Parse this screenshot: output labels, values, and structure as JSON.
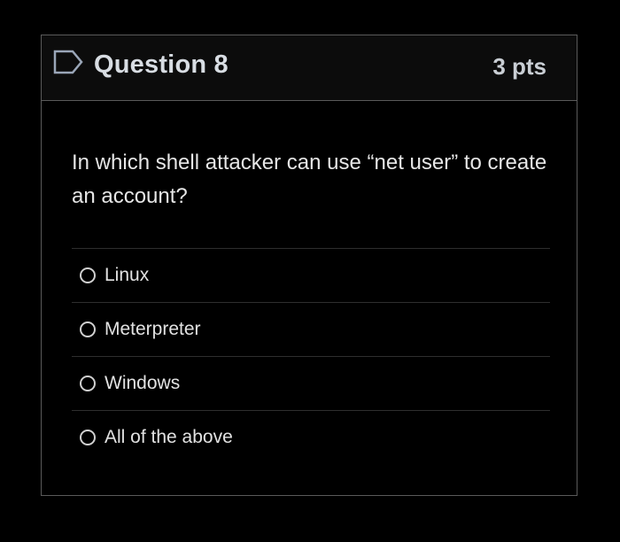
{
  "question": {
    "title": "Question 8",
    "points": "3 pts",
    "text": "In which shell attacker can use “net user” to create an account?",
    "flag_icon": "flag-outline-icon",
    "options": [
      {
        "label": "Linux",
        "selected": false
      },
      {
        "label": "Meterpreter",
        "selected": false
      },
      {
        "label": "Windows",
        "selected": false
      },
      {
        "label": "All of the above",
        "selected": false
      }
    ]
  },
  "colors": {
    "background": "#000000",
    "border": "#5a5a5a",
    "title": "#d8dde3",
    "flag": "#9aa6b8"
  }
}
